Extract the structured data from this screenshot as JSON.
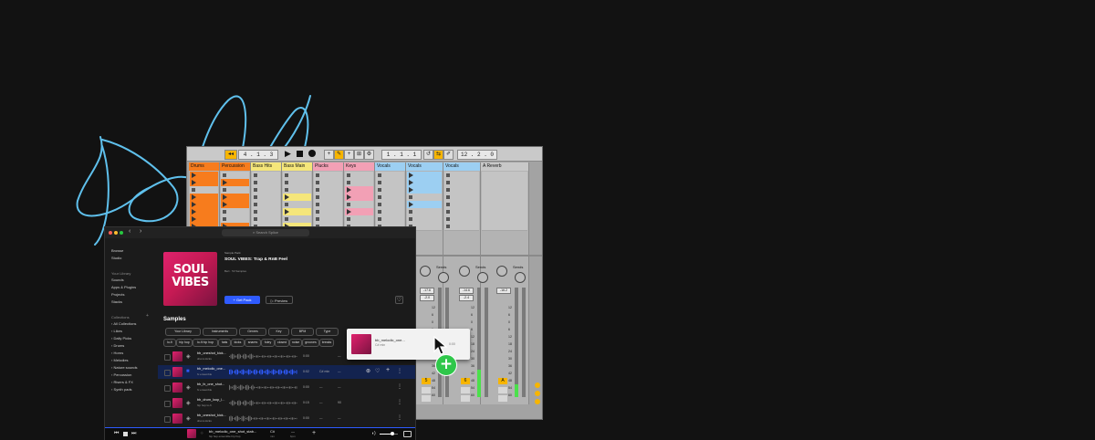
{
  "daw": {
    "transport": {
      "tempo_box": "4 . 1 . 3",
      "pos_box": "1 . 1 . 1",
      "loop_box": "12 . 2 . 0"
    },
    "tracks": [
      {
        "name": "Drums",
        "color": "#f77c1d",
        "slots": [
          "p",
          "p",
          "s",
          "p",
          "p",
          "p",
          "p",
          "p"
        ]
      },
      {
        "name": "Percussion",
        "color": "#f77c1d",
        "slots": [
          "s",
          "p",
          "s",
          "p",
          "p",
          "s",
          "s",
          "p"
        ]
      },
      {
        "name": "Bass Hits",
        "color": "#f5e67a",
        "slots": [
          "s",
          "s",
          "s",
          "s",
          "s",
          "s",
          "s",
          "s"
        ]
      },
      {
        "name": "Bass Main",
        "color": "#f5e67a",
        "slots": [
          "s",
          "s",
          "s",
          "p",
          "s",
          "p",
          "s",
          "p"
        ]
      },
      {
        "name": "Plucks",
        "color": "#f2a0b5",
        "slots": [
          "s",
          "s",
          "s",
          "s",
          "s",
          "s",
          "s",
          "s"
        ]
      },
      {
        "name": "Keys",
        "color": "#f2a0b5",
        "slots": [
          "s",
          "s",
          "p",
          "p",
          "s",
          "p",
          "s",
          "s"
        ]
      },
      {
        "name": "Vocals",
        "color": "#9ccff2",
        "slots": [
          "s",
          "s",
          "s",
          "s",
          "s",
          "s",
          "s",
          "s"
        ]
      },
      {
        "name": "Vocals",
        "color": "#9ccff2",
        "slots": [
          "p",
          "p",
          "p",
          "s",
          "p",
          "s",
          "s",
          "s"
        ]
      },
      {
        "name": "Vocals",
        "color": "#9ccff2",
        "slots": [
          "s",
          "s",
          "s",
          "s",
          "s",
          "s",
          "s",
          "s"
        ]
      },
      {
        "name": "A Reverb",
        "color": "#c8c8c8",
        "slots": []
      }
    ],
    "mixer": [
      {
        "sends": "Sends",
        "vol": "-17.6",
        "vol2": "-2.0",
        "num": "5",
        "level": 0.0
      },
      {
        "sends": "Sends",
        "vol": "-14.6",
        "vol2": "-2.4",
        "num": "6",
        "level": 0.25
      },
      {
        "sends": "Sends",
        "vol": "-16.2",
        "vol2": "",
        "num": "A",
        "level": 0.12
      }
    ],
    "fader_scale": [
      "12",
      "6",
      "0",
      "6",
      "12",
      "18",
      "24",
      "30",
      "36",
      "42",
      "48",
      "54",
      "60"
    ]
  },
  "app": {
    "search_placeholder": "Search Splice",
    "sidebar": {
      "items_top": [
        "Browse",
        "Studio"
      ],
      "library_header": "Your Library",
      "library": [
        "Sounds",
        "Apps & Plugins",
        "Projects",
        "Stacks"
      ],
      "collections_header": "Collections",
      "collections": [
        "All Collections",
        "Likes",
        "Daily Picks",
        "Drums",
        "Horns",
        "Melodies",
        "Nature sounds",
        "Percussion",
        "Risers & FX",
        "Synth pads"
      ]
    },
    "pack": {
      "label": "Sample Pack",
      "title": "SOUL VIBES: Trap & RnB Feel",
      "meta": "Bert · 53 Samples",
      "cover_line1": "SOUL",
      "cover_line2": "VIBES",
      "get_pack": "Get Pack",
      "preview": "Preview"
    },
    "samples_heading": "Samples",
    "filters": [
      "Your Library",
      "Instruments",
      "Genres",
      "Key",
      "BPM",
      "Type"
    ],
    "tags": [
      "lo-fi",
      "hip hop",
      "lo-fi hip hop",
      "hats",
      "kicks",
      "snares",
      "foley",
      "closed",
      "noise",
      "grooves",
      "breaks"
    ],
    "rows": [
      {
        "name": "bb_oneshot_kick...",
        "sub": "drums   kicks",
        "dur": "0:00",
        "key": "",
        "bpm": "—",
        "selected": false
      },
      {
        "name": "bb_melodic_one...",
        "sub": "fx   ensemble",
        "dur": "0:02",
        "key": "C# min",
        "bpm": "—",
        "selected": true
      },
      {
        "name": "bb_fx_one_shot...",
        "sub": "fx   ensemble",
        "dur": "0:00",
        "key": "—",
        "bpm": "—",
        "selected": false
      },
      {
        "name": "bb_drum_loop_l...",
        "sub": "hip hop   lo-fi",
        "dur": "0:15",
        "key": "—",
        "bpm": "90",
        "selected": false
      },
      {
        "name": "bb_oneshot_kick...",
        "sub": "drums   kicks",
        "dur": "0:00",
        "key": "—",
        "bpm": "—",
        "selected": false
      }
    ],
    "player": {
      "name": "bb_melodic_one_shot_stab...",
      "sub": "hip hop   ensemble   hip hop",
      "key": "C#",
      "key_sub": "min",
      "bpm": "—",
      "bpm_sub": "bpm"
    },
    "drag_card": {
      "name": "bb_melodic_one...",
      "sub": "C# min",
      "dur": "0:00"
    }
  }
}
